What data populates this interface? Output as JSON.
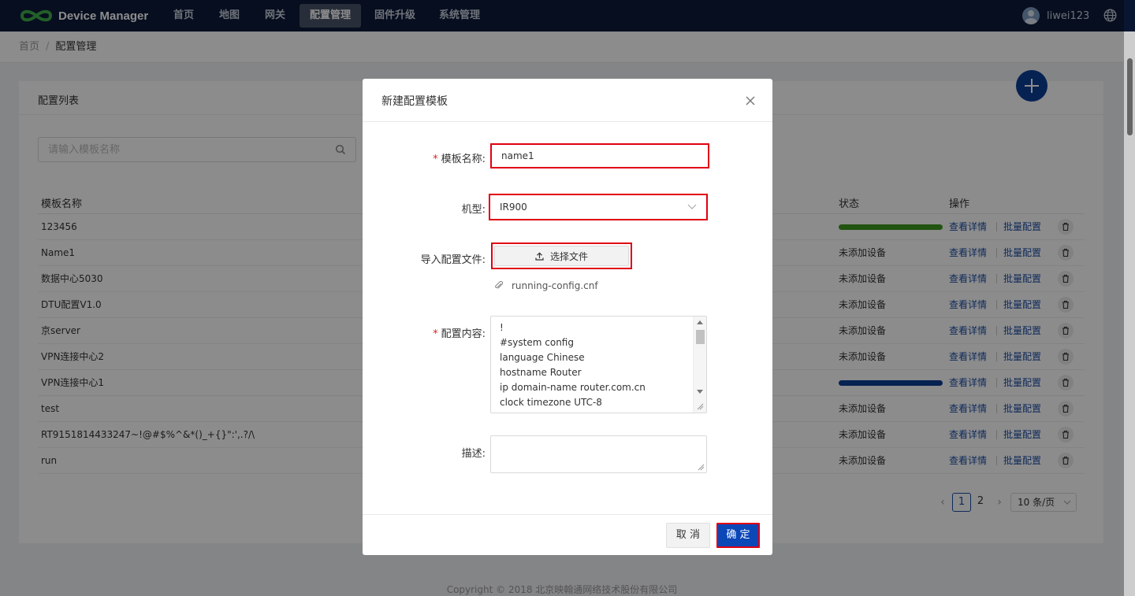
{
  "app": {
    "title": "Device Manager",
    "user": "liwei123"
  },
  "nav": [
    {
      "label": "首页"
    },
    {
      "label": "地图"
    },
    {
      "label": "网关"
    },
    {
      "label": "配置管理",
      "active": true
    },
    {
      "label": "固件升级"
    },
    {
      "label": "系统管理"
    }
  ],
  "breadcrumb": {
    "home": "首页",
    "sep": "/",
    "current": "配置管理"
  },
  "page": {
    "card_title": "配置列表",
    "search_placeholder": "请输入模板名称",
    "columns": {
      "name": "模板名称",
      "status": "状态",
      "actions": "操作"
    },
    "link_detail": "查看详情",
    "link_batch": "批量配置",
    "rows": [
      {
        "name": "123456",
        "status": "",
        "bar_color": "#3f9a1f"
      },
      {
        "name": "Name1",
        "status": "未添加设备"
      },
      {
        "name": "数据中心5030",
        "status": "未添加设备"
      },
      {
        "name": "DTU配置V1.0",
        "status": "未添加设备"
      },
      {
        "name": "京server",
        "status": "未添加设备"
      },
      {
        "name": "VPN连接中心2",
        "status": "未添加设备"
      },
      {
        "name": "VPN连接中心1",
        "status": "",
        "bar_color": "#0c3f96"
      },
      {
        "name": "test",
        "status": "未添加设备"
      },
      {
        "name": "RT9151814433247~!@#$%^&*()_+{}\":',.?/\\",
        "status": "未添加设备"
      },
      {
        "name": "run",
        "status": "未添加设备"
      }
    ],
    "pager": {
      "pages": [
        "1",
        "2"
      ],
      "current": "1",
      "page_size": "10 条/页"
    },
    "footer": "Copyright © 2018 北京映翰通网络技术股份有限公司"
  },
  "modal": {
    "title": "新建配置模板",
    "name_label": "模板名称:",
    "name_value": "name1",
    "model_label": "机型:",
    "model_value": "IR900",
    "import_label": "导入配置文件:",
    "upload_button": "选择文件",
    "file_name": "running-config.cnf",
    "content_label": "配置内容:",
    "content_lines": [
      "!",
      "#system config",
      "language Chinese",
      "hostname Router",
      "ip domain-name router.com.cn",
      "clock timezone UTC-8"
    ],
    "desc_label": "描述:",
    "cancel": "取 消",
    "ok": "确 定"
  },
  "colors": {
    "nav_bg": "#0c1a3a",
    "primary": "#0c47b8",
    "link": "#1c4ea5",
    "highlight_box": "#e00012"
  }
}
